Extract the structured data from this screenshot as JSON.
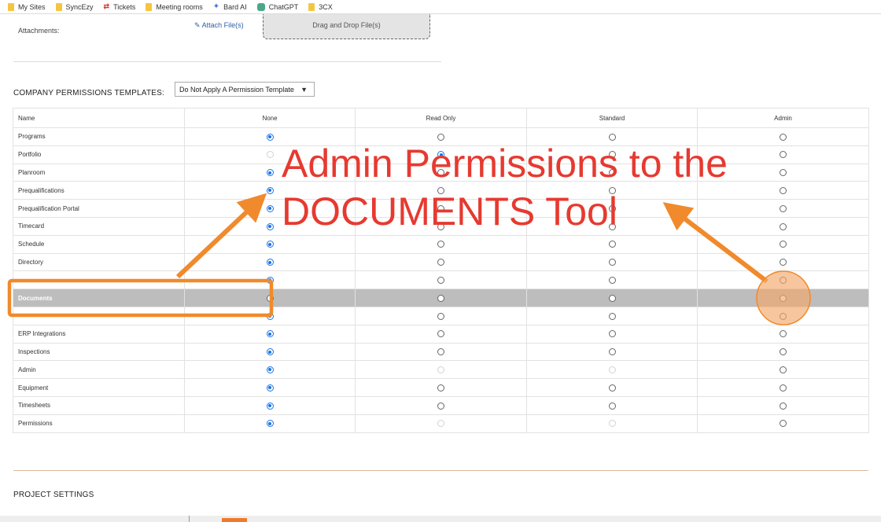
{
  "bookmarks": [
    {
      "label": "My Sites",
      "icon": "folder-icon"
    },
    {
      "label": "SyncEzy",
      "icon": "folder-icon"
    },
    {
      "label": "Tickets",
      "icon": "tickets-icon"
    },
    {
      "label": "Meeting rooms",
      "icon": "folder-icon"
    },
    {
      "label": "Bard AI",
      "icon": "sparkle-icon"
    },
    {
      "label": "ChatGPT",
      "icon": "chatgpt-icon"
    },
    {
      "label": "3CX",
      "icon": "folder-icon"
    }
  ],
  "attachments": {
    "label": "Attachments:",
    "attach_link": "Attach File(s)",
    "dropzone": "Drag and Drop File(s)"
  },
  "templates": {
    "label": "COMPANY PERMISSIONS TEMPLATES:",
    "selected": "Do Not Apply A Permission Template"
  },
  "table": {
    "headers": [
      "Name",
      "None",
      "Read Only",
      "Standard",
      "Admin"
    ],
    "rows": [
      {
        "name": "Programs",
        "selected": 0,
        "disabled": []
      },
      {
        "name": "Portfolio",
        "selected": 1,
        "disabled": [
          0
        ]
      },
      {
        "name": "Planroom",
        "selected": 0,
        "disabled": []
      },
      {
        "name": "Prequalifications",
        "selected": 0,
        "disabled": []
      },
      {
        "name": "Prequalification Portal",
        "selected": 0,
        "disabled": []
      },
      {
        "name": "Timecard",
        "selected": 0,
        "disabled": []
      },
      {
        "name": "Schedule",
        "selected": 0,
        "disabled": []
      },
      {
        "name": "Directory",
        "selected": 0,
        "disabled": []
      },
      {
        "name": "",
        "selected": 0,
        "disabled": []
      },
      {
        "name": "Documents",
        "selected": -1,
        "disabled": [],
        "highlight": true
      },
      {
        "name": "",
        "selected": 0,
        "disabled": []
      },
      {
        "name": "ERP Integrations",
        "selected": 0,
        "disabled": []
      },
      {
        "name": "Inspections",
        "selected": 0,
        "disabled": []
      },
      {
        "name": "Admin",
        "selected": 0,
        "disabled": [
          1,
          2
        ]
      },
      {
        "name": "Equipment",
        "selected": 0,
        "disabled": []
      },
      {
        "name": "Timesheets",
        "selected": 0,
        "disabled": []
      },
      {
        "name": "Permissions",
        "selected": 0,
        "disabled": [
          1,
          2
        ]
      }
    ]
  },
  "annotation": {
    "line1": "Admin Permissions to the",
    "line2": "DOCUMENTS Tool",
    "color": "#e63a30",
    "arrow_color": "#f08a2c"
  },
  "project_settings": "PROJECT SETTINGS"
}
